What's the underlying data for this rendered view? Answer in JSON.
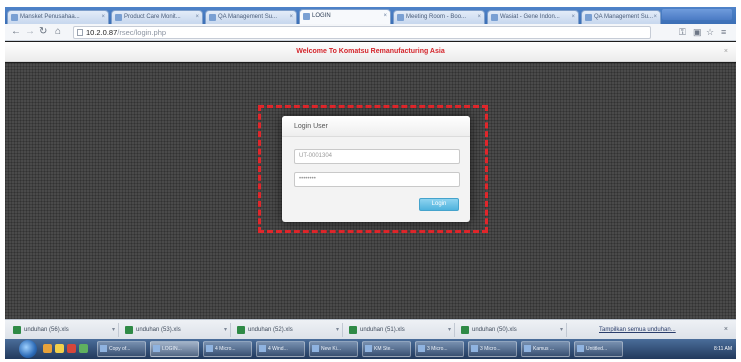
{
  "browser": {
    "tabs": [
      {
        "label": "Mansket Penusahaa...",
        "active": false
      },
      {
        "label": "Product Care Monit...",
        "active": false
      },
      {
        "label": "QA Management Su...",
        "active": false
      },
      {
        "label": "LOGIN",
        "active": true
      },
      {
        "label": "Meeting Room - Boo...",
        "active": false
      },
      {
        "label": "Wasiat - Gene Indon...",
        "active": false
      },
      {
        "label": "QA Management Su...",
        "active": false
      }
    ],
    "address": {
      "host": "10.2.0.87",
      "path": "/rsec/login.php"
    }
  },
  "page": {
    "header_title": "Welcome To Komatsu Remanufacturing Asia",
    "header_close": "×"
  },
  "login": {
    "title": "Login User",
    "username_value": "UT-0001304",
    "password_mask": "••••••••",
    "button_label": "Login"
  },
  "downloads": {
    "items": [
      "unduhan (56).xls",
      "unduhan (53).xls",
      "unduhan (52).xls",
      "unduhan (51).xls",
      "unduhan (50).xls"
    ],
    "show_all": "Tampilkan semua unduhan...",
    "close": "×"
  },
  "taskbar": {
    "items": [
      "Copy of...",
      "LOGIN...",
      "4 Micro...",
      "4 Wind...",
      "New Ki...",
      "KM Ste...",
      "3 Micro...",
      "3 Micro...",
      "Kamus ...",
      "Untitled..."
    ],
    "clock": "8:11 AM"
  },
  "colors": {
    "accent_red": "#e0262b",
    "header_text": "#d4252b",
    "login_button": "#4fb2dd"
  }
}
